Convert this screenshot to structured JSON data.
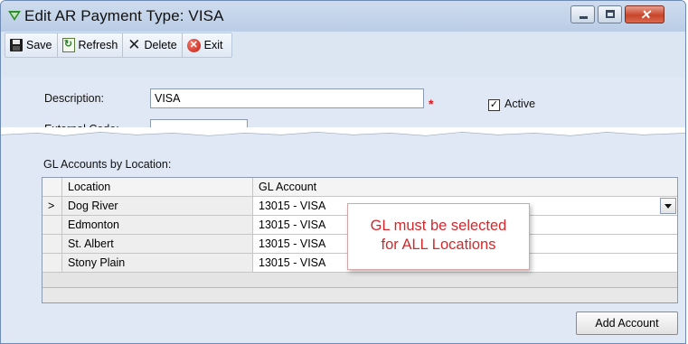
{
  "window": {
    "title": "Edit AR Payment Type: VISA"
  },
  "toolbar": {
    "save_label": "Save",
    "refresh_label": "Refresh",
    "delete_label": "Delete",
    "exit_label": "Exit"
  },
  "form": {
    "description_label": "Description:",
    "description_value": "VISA",
    "required_marker": "*",
    "active_label": "Active",
    "active_checked": true,
    "external_code_label": "External Code:",
    "external_code_value": ""
  },
  "gl_section": {
    "label": "GL Accounts by Location:",
    "columns": [
      "Location",
      "GL Account"
    ],
    "rows": [
      {
        "indicator": ">",
        "location": "Dog River",
        "gl_account": "13015 - VISA"
      },
      {
        "indicator": "",
        "location": "Edmonton",
        "gl_account": "13015 - VISA"
      },
      {
        "indicator": "",
        "location": "St. Albert",
        "gl_account": "13015 - VISA"
      },
      {
        "indicator": "",
        "location": "Stony Plain",
        "gl_account": "13015 - VISA"
      }
    ]
  },
  "callout": {
    "line1": "GL must be selected",
    "line2": "for ALL Locations"
  },
  "add_account_label": "Add Account",
  "icons": {
    "title": "green-triangle-icon",
    "save": "floppy-disk-icon",
    "refresh": "refresh-icon",
    "delete": "x-delete-icon",
    "exit": "red-exit-icon"
  },
  "colors": {
    "titlebar": "#c4d4ea",
    "callout_text": "#d3282c",
    "required": "#e0141c"
  }
}
